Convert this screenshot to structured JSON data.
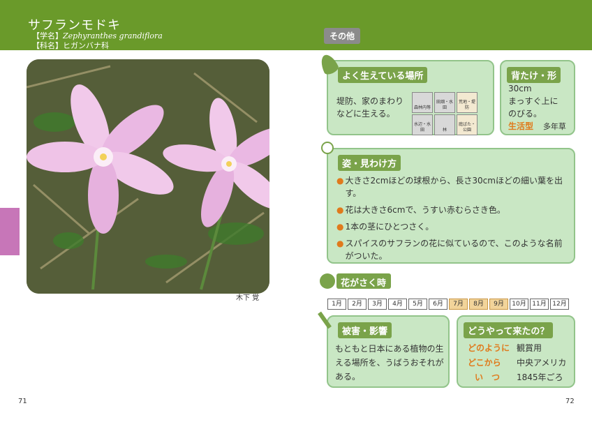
{
  "header": {
    "title": "サフランモドキ",
    "scientific_label": "【学名】",
    "scientific_name": "Zephyranthes grandiflora",
    "family_label": "【科名】",
    "family_name": "ヒガンバナ科"
  },
  "photo": {
    "credit": "木下 覚"
  },
  "tag": "その他",
  "habitat": {
    "heading": "よく生えている場所",
    "text_line1": "堤防、家のまわり",
    "text_line2": "などに生える。",
    "tiles": [
      "森林内等",
      "田畑・水田",
      "荒地・堤防",
      "",
      "水辺・水田",
      "林",
      "庭ばた・公園",
      ""
    ]
  },
  "height": {
    "heading": "背たけ・形",
    "size": "30cm",
    "line2": "まっすぐ上に",
    "line3": "のびる。",
    "type_label": "生活型",
    "type_value": "多年草"
  },
  "appearance": {
    "heading": "姿・見わけ方",
    "bullets": [
      "大きさ2cmほどの球根から、長さ30cmほどの細い葉を出す。",
      "花は大きさ6cmで、うすい赤むらさき色。",
      "1本の茎にひとつさく。",
      "スパイスのサフランの花に似ているので、このような名前がついた。"
    ]
  },
  "flowering": {
    "heading": "花がさく時",
    "months": [
      "1月",
      "2月",
      "3月",
      "4月",
      "5月",
      "6月",
      "7月",
      "8月",
      "9月",
      "10月",
      "11月",
      "12月"
    ],
    "active": [
      7,
      8
    ]
  },
  "damage": {
    "heading": "被害・影響",
    "line1": "もともと日本にある植物の生",
    "line2": "える場所を、うばうおそれが",
    "line3": "ある。"
  },
  "origin": {
    "heading": "どうやって来たの？",
    "how_label": "どのように",
    "how_value": "観賞用",
    "where_label": "どこから",
    "where_value": "中央アメリカ",
    "when_label": "い　つ",
    "when_value": "1845年ごろ"
  },
  "page_numbers": {
    "left": "71",
    "right": "72"
  },
  "colors": {
    "green_band": "#6a9a2a",
    "card_bg": "#c9e7c4",
    "accent_orange": "#e07a1c",
    "pink_tab": "#c776b8"
  }
}
